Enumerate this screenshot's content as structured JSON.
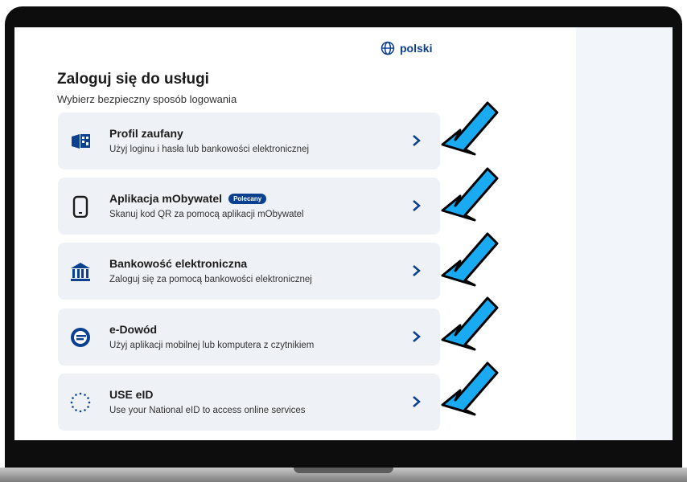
{
  "language": {
    "label": "polski"
  },
  "page": {
    "title": "Zaloguj się do usługi",
    "subtitle": "Wybierz bezpieczny sposób logowania"
  },
  "options": [
    {
      "title": "Profil zaufany",
      "description": "Użyj loginu i hasła lub bankowości elektronicznej",
      "icon": "profil-zaufany-icon"
    },
    {
      "title": "Aplikacja mObywatel",
      "badge": "Polecany",
      "description": "Skanuj kod QR za pomocą aplikacji mObywatel",
      "icon": "phone-icon"
    },
    {
      "title": "Bankowość elektroniczna",
      "description": "Zaloguj się za pomocą bankowości elektronicznej",
      "icon": "bank-icon"
    },
    {
      "title": "e-Dowód",
      "description": "Użyj aplikacji mobilnej lub komputera z czytnikiem",
      "icon": "e-dowod-icon"
    },
    {
      "title": "USE eID",
      "description": "Use your National eID to access online services",
      "icon": "eu-stars-icon"
    }
  ],
  "colors": {
    "accent": "#0b3f8f",
    "card_background": "#eef2f7",
    "arrow_fill": "#19aaf2"
  }
}
